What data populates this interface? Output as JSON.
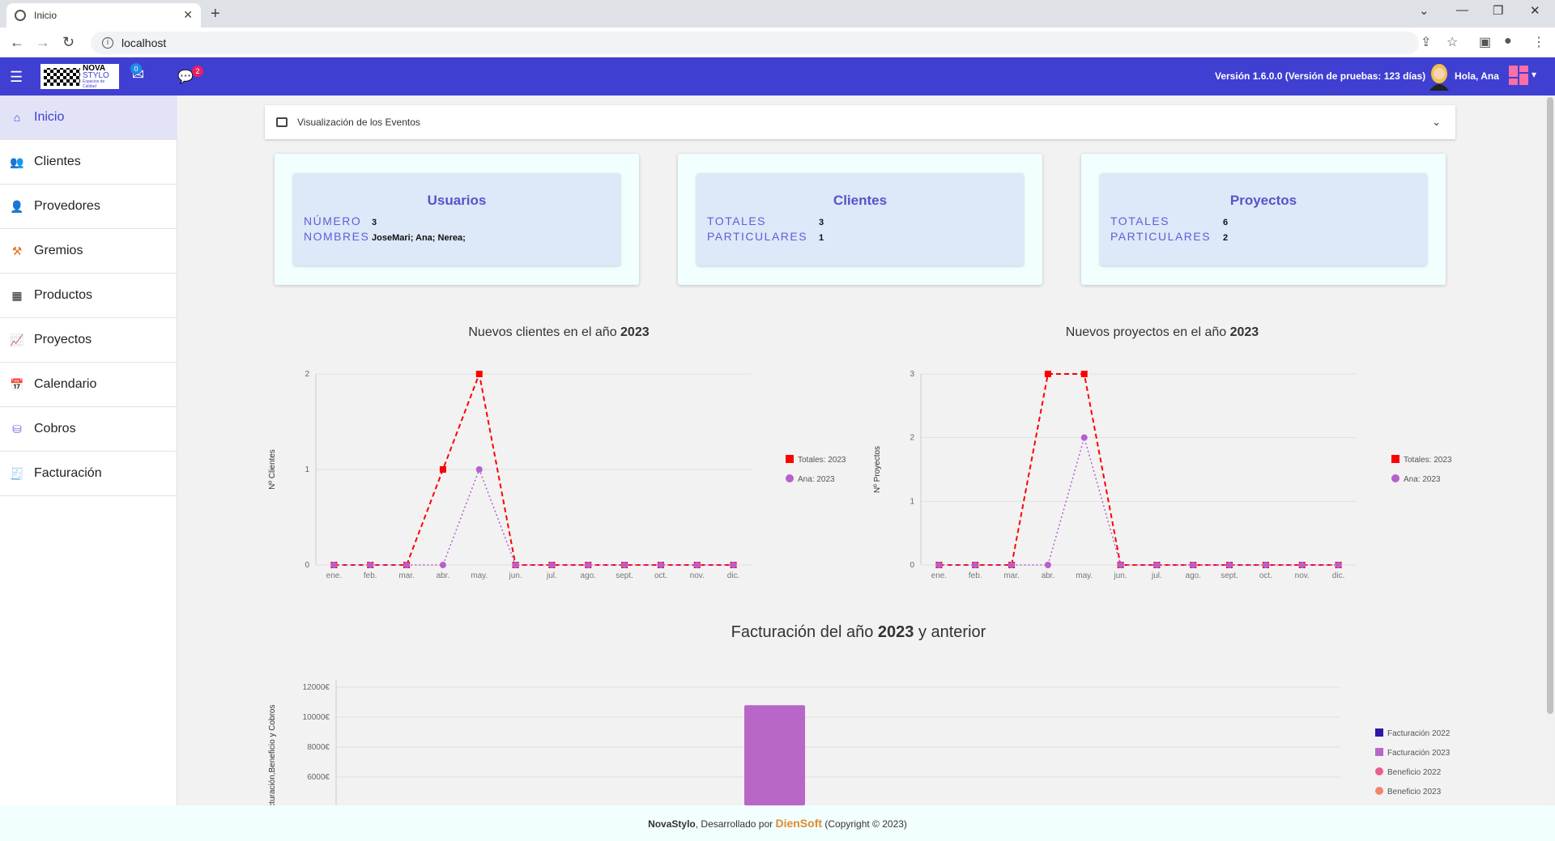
{
  "browser": {
    "tab_title": "Inicio",
    "url": "localhost"
  },
  "app": {
    "logo_line1": "NOVA",
    "logo_line2": "STYLO",
    "logo_tagline": "Espacios de Calidad",
    "mail_count": "0",
    "chat_count": "2",
    "version": "Versión 1.6.0.0 (Versión de pruebas: 123 días)",
    "greeting": "Hola, Ana"
  },
  "sidebar": {
    "items": [
      {
        "label": "Inicio",
        "icon": "home-icon"
      },
      {
        "label": "Clientes",
        "icon": "clients-icon"
      },
      {
        "label": "Provedores",
        "icon": "suppliers-icon"
      },
      {
        "label": "Gremios",
        "icon": "guilds-icon"
      },
      {
        "label": "Productos",
        "icon": "products-icon"
      },
      {
        "label": "Proyectos",
        "icon": "projects-icon"
      },
      {
        "label": "Calendario",
        "icon": "calendar-icon"
      },
      {
        "label": "Cobros",
        "icon": "payments-icon"
      },
      {
        "label": "Facturación",
        "icon": "invoice-icon"
      }
    ]
  },
  "events_panel": {
    "label": "Visualización de los Eventos"
  },
  "cards": {
    "usuarios": {
      "title": "Usuarios",
      "row1_label": "NÚMERO",
      "row1_value": "3",
      "row2_label": "NOMBRES",
      "row2_value": "JoseMari; Ana; Nerea;"
    },
    "clientes": {
      "title": "Clientes",
      "row1_label": "TOTALES",
      "row1_value": "3",
      "row2_label": "PARTICULARES",
      "row2_value": "1"
    },
    "proyectos": {
      "title": "Proyectos",
      "row1_label": "TOTALES",
      "row1_value": "6",
      "row2_label": "PARTICULARES",
      "row2_value": "2"
    }
  },
  "chart_titles": {
    "clients_prefix": "Nuevos clientes en el año ",
    "clients_year": "2023",
    "projects_prefix": "Nuevos proyectos en el año ",
    "projects_year": "2023",
    "billing_prefix": "Facturación del año ",
    "billing_year": "2023",
    "billing_suffix": " y anterior"
  },
  "chart_data": [
    {
      "type": "line",
      "title": "Nuevos clientes en el año 2023",
      "ylabel": "Nº Clientes",
      "xlabel": "",
      "categories": [
        "ene.",
        "feb.",
        "mar.",
        "abr.",
        "may.",
        "jun.",
        "jul.",
        "ago.",
        "sept.",
        "oct.",
        "nov.",
        "dic."
      ],
      "ylim": [
        0,
        2
      ],
      "yticks": [
        "0",
        "1",
        "2"
      ],
      "legend_position": "right",
      "series": [
        {
          "name": "Totales: 2023",
          "color": "#ff0000",
          "marker": "square",
          "style": "dashed",
          "values": [
            0,
            0,
            0,
            1,
            2,
            0,
            0,
            0,
            0,
            0,
            0,
            0
          ]
        },
        {
          "name": "Ana: 2023",
          "color": "#b65fcf",
          "marker": "circle",
          "style": "dotted",
          "values": [
            0,
            0,
            0,
            0,
            1,
            0,
            0,
            0,
            0,
            0,
            0,
            0
          ]
        }
      ]
    },
    {
      "type": "line",
      "title": "Nuevos proyectos en el año 2023",
      "ylabel": "Nº Proyectos",
      "xlabel": "",
      "categories": [
        "ene.",
        "feb.",
        "mar.",
        "abr.",
        "may.",
        "jun.",
        "jul.",
        "ago.",
        "sept.",
        "oct.",
        "nov.",
        "dic."
      ],
      "ylim": [
        0,
        3
      ],
      "yticks": [
        "0",
        "1",
        "2",
        "3"
      ],
      "legend_position": "right",
      "series": [
        {
          "name": "Totales: 2023",
          "color": "#ff0000",
          "marker": "square",
          "style": "dashed",
          "values": [
            0,
            0,
            0,
            3,
            3,
            0,
            0,
            0,
            0,
            0,
            0,
            0
          ]
        },
        {
          "name": "Ana: 2023",
          "color": "#b65fcf",
          "marker": "circle",
          "style": "dotted",
          "values": [
            0,
            0,
            0,
            0,
            2,
            0,
            0,
            0,
            0,
            0,
            0,
            0
          ]
        }
      ]
    },
    {
      "type": "bar",
      "title": "Facturación del año 2023 y anterior",
      "ylabel": "Facturación,Beneficio y Cobros",
      "yticks": [
        "12000€",
        "10000€",
        "8000€",
        "6000€"
      ],
      "ylim": [
        0,
        12000
      ],
      "legend_position": "right",
      "series": [
        {
          "name": "Facturación 2022",
          "color": "#2b1aa8",
          "marker": "square"
        },
        {
          "name": "Facturación 2023",
          "color": "#b866c8",
          "marker": "square",
          "values": [
            10800
          ]
        },
        {
          "name": "Beneficio 2022",
          "color": "#e8608a",
          "marker": "circle"
        },
        {
          "name": "Beneficio 2023",
          "color": "#f0866a",
          "marker": "circle"
        }
      ]
    }
  ],
  "footer": {
    "app_name": "NovaStylo",
    "developed_by": ", Desarrollado por ",
    "company": "DienSoft",
    "copyright": " (Copyright © 2023)"
  }
}
